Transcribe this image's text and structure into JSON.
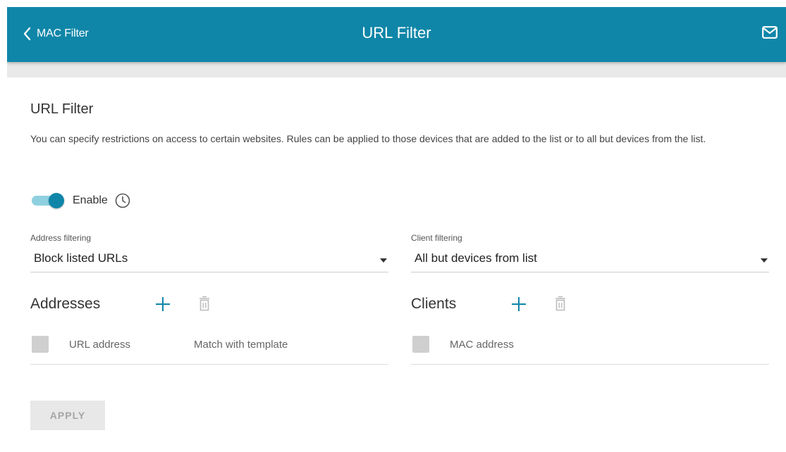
{
  "header": {
    "back_label": "MAC Filter",
    "title": "URL Filter"
  },
  "section": {
    "title": "URL Filter",
    "description": "You can specify restrictions on access to certain websites. Rules can be applied to those devices that are added to the list or to all but devices from the list."
  },
  "enable": {
    "label": "Enable",
    "on": true
  },
  "address_filtering": {
    "label": "Address filtering",
    "value": "Block listed URLs"
  },
  "client_filtering": {
    "label": "Client filtering",
    "value": "All but devices from list"
  },
  "addresses": {
    "title": "Addresses",
    "columns": [
      "URL address",
      "Match with template"
    ]
  },
  "clients": {
    "title": "Clients",
    "columns": [
      "MAC address"
    ]
  },
  "apply_label": "APPLY",
  "colors": {
    "header_bg": "#0f86a8",
    "accent": "#0f86a8",
    "toggle_track": "#8fd0e0",
    "button_disabled_bg": "#e8e8e8"
  },
  "icons": [
    "chevron-left-icon",
    "mail-icon",
    "clock-icon",
    "plus-icon",
    "trash-icon",
    "chevron-down-icon"
  ]
}
